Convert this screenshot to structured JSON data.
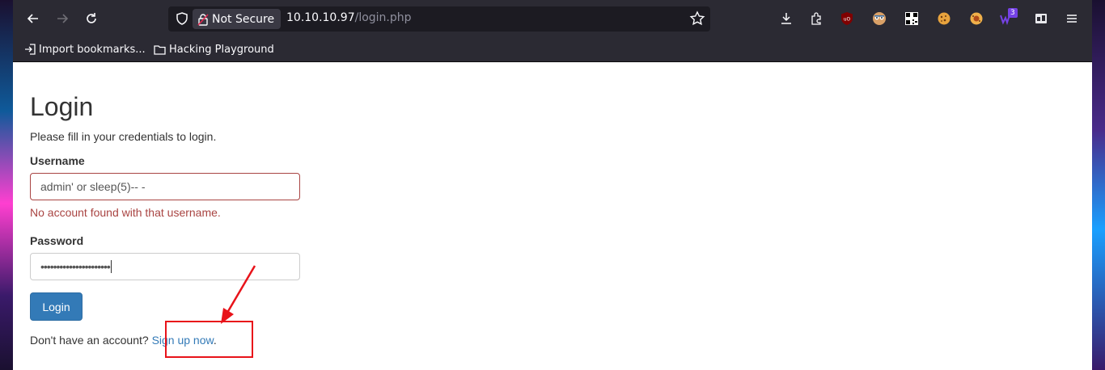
{
  "browser": {
    "security_label": "Not Secure",
    "url_host": "10.10.10.97",
    "url_path": "/login.php",
    "extension_badge": "3"
  },
  "bookmarks": [
    {
      "label": "Import bookmarks...",
      "icon": "import-icon"
    },
    {
      "label": "Hacking Playground",
      "icon": "folder-icon"
    }
  ],
  "toolbar_icons": [
    "download-icon",
    "extensions-icon",
    "ublock-icon",
    "privacy-badger-icon",
    "qr-code-icon",
    "cookie-icon",
    "cookie-editor-icon",
    "wappalyzer-icon",
    "container-icon",
    "menu-icon"
  ],
  "login": {
    "title": "Login",
    "intro": "Please fill in your credentials to login.",
    "username_label": "Username",
    "username_value": "admin' or sleep(5)-- -",
    "username_error": "No account found with that username.",
    "password_label": "Password",
    "password_value": "••••••••••••••••••••••",
    "submit_label": "Login",
    "signup_prefix": "Don't have an account?",
    "signup_link": "Sign up now",
    "signup_suffix": "."
  },
  "colors": {
    "primary": "#337ab7",
    "error": "#a94442",
    "annotation": "#e8131a",
    "toolbar_bg": "#2b2a33"
  }
}
